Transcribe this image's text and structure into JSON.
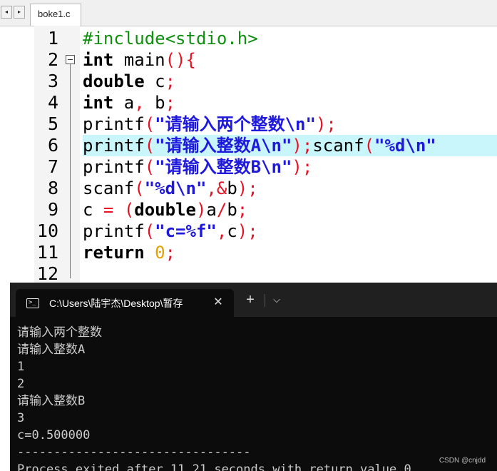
{
  "editor": {
    "tab_prev_icon": "◂",
    "tab_next_icon": "▸",
    "file_tab": "boke1.c",
    "line_numbers": [
      "1",
      "2",
      "3",
      "4",
      "5",
      "6",
      "7",
      "8",
      "9",
      "10",
      "11",
      "12"
    ],
    "highlighted_line": 6,
    "code_lines": [
      [
        [
          "pre",
          "#include<stdio.h>"
        ]
      ],
      [
        [
          "kw",
          "int"
        ],
        [
          "plain",
          " main"
        ],
        [
          "op",
          "(){"
        ]
      ],
      [
        [
          "kw",
          "double"
        ],
        [
          "plain",
          " c"
        ],
        [
          "op",
          ";"
        ]
      ],
      [
        [
          "kw",
          "int"
        ],
        [
          "plain",
          " a"
        ],
        [
          "op",
          ","
        ],
        [
          "plain",
          " b"
        ],
        [
          "op",
          ";"
        ]
      ],
      [
        [
          "plain",
          "printf"
        ],
        [
          "op",
          "("
        ],
        [
          "str",
          "\"请输入两个整数\\n\""
        ],
        [
          "op",
          ");"
        ]
      ],
      [
        [
          "plain",
          "printf"
        ],
        [
          "op",
          "("
        ],
        [
          "str",
          "\"请输入整数A\\n\""
        ],
        [
          "op",
          ");"
        ],
        [
          "plain",
          "scanf"
        ],
        [
          "op",
          "("
        ],
        [
          "str",
          "\"%d\\n\""
        ]
      ],
      [
        [
          "plain",
          "printf"
        ],
        [
          "op",
          "("
        ],
        [
          "str",
          "\"请输入整数B\\n\""
        ],
        [
          "op",
          ");"
        ]
      ],
      [
        [
          "plain",
          "scanf"
        ],
        [
          "op",
          "("
        ],
        [
          "str",
          "\"%d\\n\""
        ],
        [
          "op",
          ",&"
        ],
        [
          "plain",
          "b"
        ],
        [
          "op",
          ");"
        ]
      ],
      [
        [
          "plain",
          "c "
        ],
        [
          "op",
          "="
        ],
        [
          "plain",
          " "
        ],
        [
          "op",
          "("
        ],
        [
          "kw",
          "double"
        ],
        [
          "op",
          ")"
        ],
        [
          "plain",
          "a"
        ],
        [
          "op",
          "/"
        ],
        [
          "plain",
          "b"
        ],
        [
          "op",
          ";"
        ]
      ],
      [
        [
          "plain",
          "printf"
        ],
        [
          "op",
          "("
        ],
        [
          "str",
          "\"c=%f\""
        ],
        [
          "op",
          ","
        ],
        [
          "plain",
          "c"
        ],
        [
          "op",
          ");"
        ]
      ],
      [
        [
          "kw",
          "return"
        ],
        [
          "plain",
          " "
        ],
        [
          "num",
          "0"
        ],
        [
          "op",
          ";"
        ]
      ],
      []
    ]
  },
  "terminal": {
    "icon_glyph": ">_",
    "tab_title": "C:\\Users\\陆宇杰\\Desktop\\暂存",
    "close_icon": "✕",
    "add_icon": "+",
    "dropdown_icon": "⌵",
    "output_lines": [
      "请输入两个整数",
      "请输入整数A",
      "1",
      "2",
      "请输入整数B",
      "3",
      "c=0.500000",
      "--------------------------------",
      "Process exited after 11.21 seconds with return value 0"
    ]
  },
  "watermark": "CSDN @cnjdd"
}
